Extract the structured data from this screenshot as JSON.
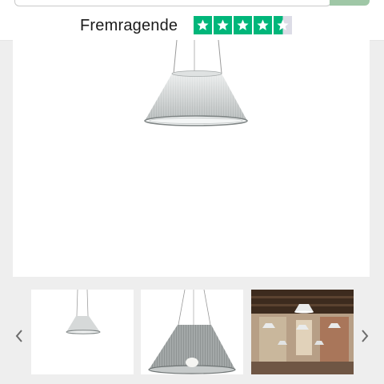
{
  "rating": {
    "label": "Fremragende",
    "stars": 4.5,
    "max_stars": 5,
    "star_color": "#00b67a"
  },
  "gallery": {
    "main_image": "pendant-lamp-glass-shade",
    "thumbnails": [
      {
        "name": "pendant-lamp-clear-thumbnail"
      },
      {
        "name": "pendant-lamp-grey-thumbnail"
      },
      {
        "name": "pendant-lamp-interior-thumbnail"
      }
    ],
    "prev_icon": "chevron-left-icon",
    "next_icon": "chevron-right-icon"
  },
  "colors": {
    "accent": "#9fc7a6",
    "background": "#eeeeee"
  }
}
